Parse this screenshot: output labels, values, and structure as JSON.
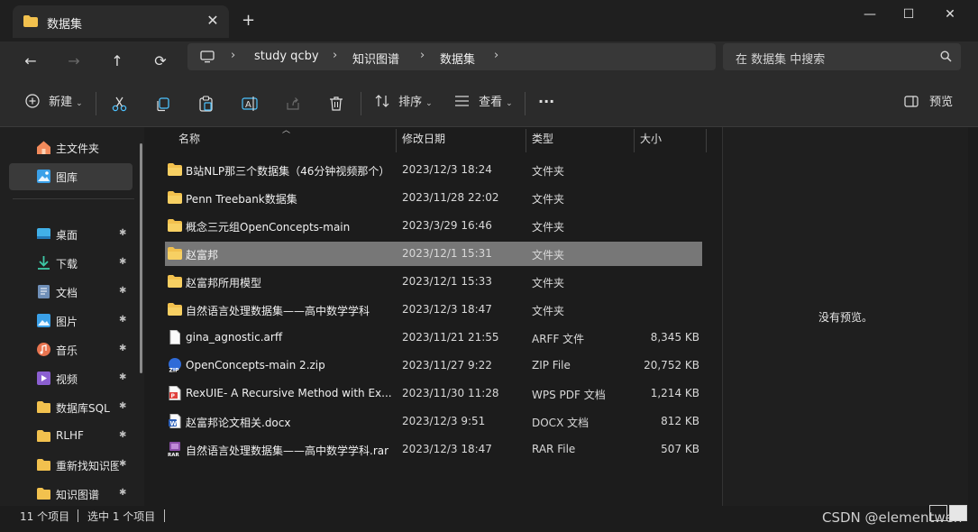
{
  "tab": {
    "title": "数据集",
    "close_icon": "✕",
    "newtab_icon": "+"
  },
  "window": {
    "minimize": "—",
    "maximize": "☐",
    "close": "✕"
  },
  "nav": {
    "back": "←",
    "forward": "→",
    "up": "↑",
    "refresh": "⟳",
    "breadcrumb": [
      "study qcby",
      "知识图谱",
      "数据集"
    ],
    "sep": "›",
    "search_placeholder": "在 数据集 中搜索"
  },
  "toolbar": {
    "new_label": "新建",
    "sort_label": "排序",
    "view_label": "查看",
    "more_label": "···",
    "preview_label": "预览"
  },
  "sidebar": {
    "top": [
      {
        "label": "主文件夹",
        "icon": "home-icon"
      },
      {
        "label": "图库",
        "icon": "gallery-icon"
      }
    ],
    "quick": [
      {
        "label": "桌面",
        "icon": "desktop-icon"
      },
      {
        "label": "下载",
        "icon": "download-icon"
      },
      {
        "label": "文档",
        "icon": "documents-icon"
      },
      {
        "label": "图片",
        "icon": "pictures-icon"
      },
      {
        "label": "音乐",
        "icon": "music-icon"
      },
      {
        "label": "视频",
        "icon": "videos-icon"
      },
      {
        "label": "数据库SQL",
        "icon": "folder-icon"
      },
      {
        "label": "RLHF",
        "icon": "folder-icon"
      },
      {
        "label": "重新找知识图",
        "icon": "folder-icon"
      },
      {
        "label": "知识图谱",
        "icon": "folder-icon"
      }
    ],
    "pin_glyph": "📌"
  },
  "columns": {
    "name": "名称",
    "date": "修改日期",
    "type": "类型",
    "size": "大小"
  },
  "files": [
    {
      "name": "B站NLP那三个数据集（46分钟视频那个）",
      "date": "2023/12/3 18:24",
      "type": "文件夹",
      "size": "",
      "icon": "folder-icon"
    },
    {
      "name": "Penn Treebank数据集",
      "date": "2023/11/28 22:02",
      "type": "文件夹",
      "size": "",
      "icon": "folder-icon"
    },
    {
      "name": "概念三元组OpenConcepts-main",
      "date": "2023/3/29 16:46",
      "type": "文件夹",
      "size": "",
      "icon": "folder-icon"
    },
    {
      "name": "赵富邦",
      "date": "2023/12/1 15:31",
      "type": "文件夹",
      "size": "",
      "icon": "folder-icon"
    },
    {
      "name": "赵富邦所用模型",
      "date": "2023/12/1 15:33",
      "type": "文件夹",
      "size": "",
      "icon": "folder-icon"
    },
    {
      "name": "自然语言处理数据集——高中数学学科",
      "date": "2023/12/3 18:47",
      "type": "文件夹",
      "size": "",
      "icon": "folder-icon"
    },
    {
      "name": "gina_agnostic.arff",
      "date": "2023/11/21 21:55",
      "type": "ARFF 文件",
      "size": "8,345 KB",
      "icon": "file-icon"
    },
    {
      "name": "OpenConcepts-main 2.zip",
      "date": "2023/11/27 9:22",
      "type": "ZIP File",
      "size": "20,752 KB",
      "icon": "zip-icon"
    },
    {
      "name": "RexUIE- A Recursive Method with Ex...",
      "date": "2023/11/30 11:28",
      "type": "WPS PDF 文档",
      "size": "1,214 KB",
      "icon": "pdf-icon"
    },
    {
      "name": "赵富邦论文相关.docx",
      "date": "2023/12/3 9:51",
      "type": "DOCX 文档",
      "size": "812 KB",
      "icon": "docx-icon"
    },
    {
      "name": "自然语言处理数据集——高中数学学科.rar",
      "date": "2023/12/3 18:47",
      "type": "RAR File",
      "size": "507 KB",
      "icon": "rar-icon"
    }
  ],
  "selected_index": 3,
  "preview_message": "没有预览。",
  "status": {
    "count": "11 个项目",
    "selected": "选中 1 个项目"
  },
  "watermark": "CSDN @elementwen",
  "colors": {
    "folder": "#f2c14e",
    "selected_row": "#777777",
    "accent": "#4cc2ff"
  }
}
